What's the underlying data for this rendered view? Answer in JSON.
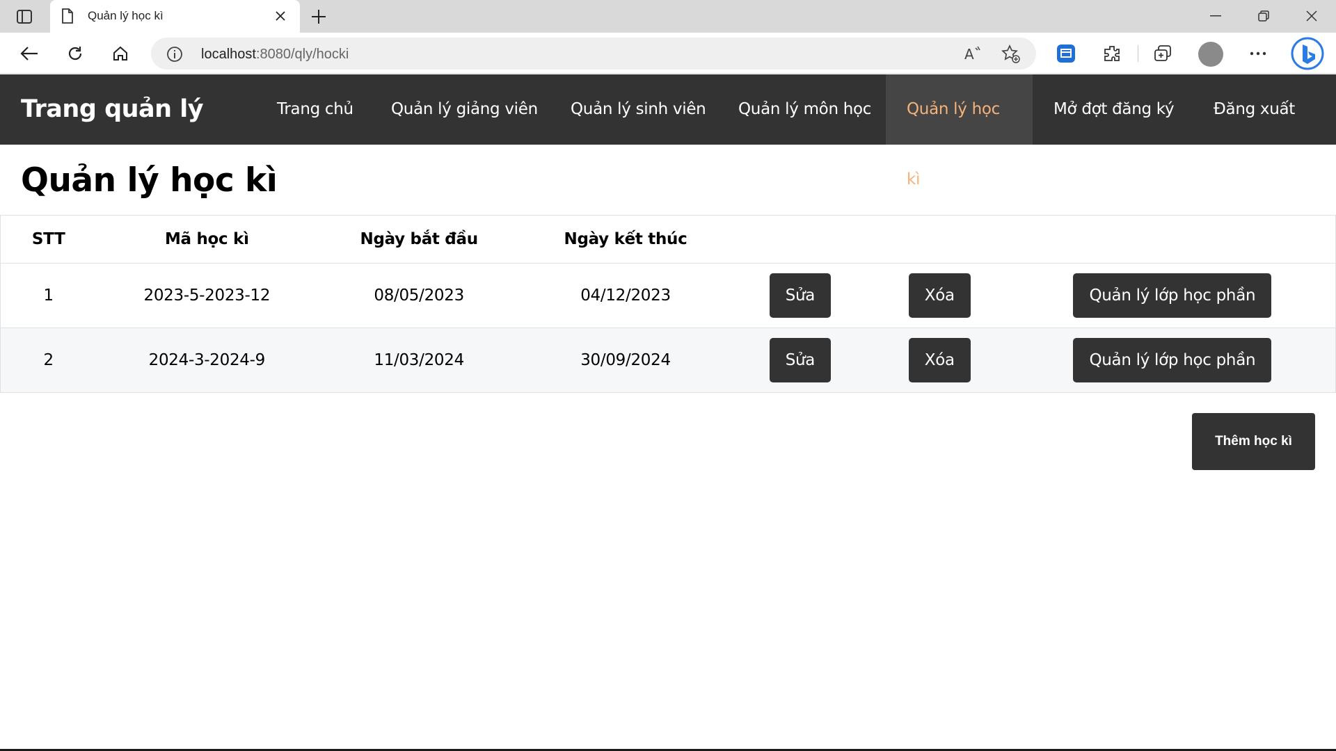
{
  "browser": {
    "tab_title": "Quản lý học kì",
    "url_host": "localhost",
    "url_rest": ":8080/qly/hocki"
  },
  "navbar": {
    "brand": "Trang quản lý",
    "items": [
      {
        "label": "Trang chủ"
      },
      {
        "label": "Quản lý giảng viên"
      },
      {
        "label": "Quản lý sinh viên"
      },
      {
        "label": "Quản lý môn học"
      },
      {
        "label": "Quản lý học kì",
        "active": true
      },
      {
        "label": "Mở đợt đăng ký"
      },
      {
        "label": "Đăng xuất"
      }
    ],
    "active_color": "#f5b27a"
  },
  "main": {
    "title": "Quản lý học kì",
    "table": {
      "headers": [
        "STT",
        "Mã học kì",
        "Ngày bắt đầu",
        "Ngày kết thúc"
      ],
      "rows": [
        {
          "stt": "1",
          "ma": "2023-5-2023-12",
          "start": "08/05/2023",
          "end": "04/12/2023"
        },
        {
          "stt": "2",
          "ma": "2024-3-2024-9",
          "start": "11/03/2024",
          "end": "30/09/2024"
        }
      ],
      "edit_label": "Sửa",
      "delete_label": "Xóa",
      "manage_label": "Quản lý lớp học phần"
    },
    "add_label": "Thêm học kì"
  }
}
